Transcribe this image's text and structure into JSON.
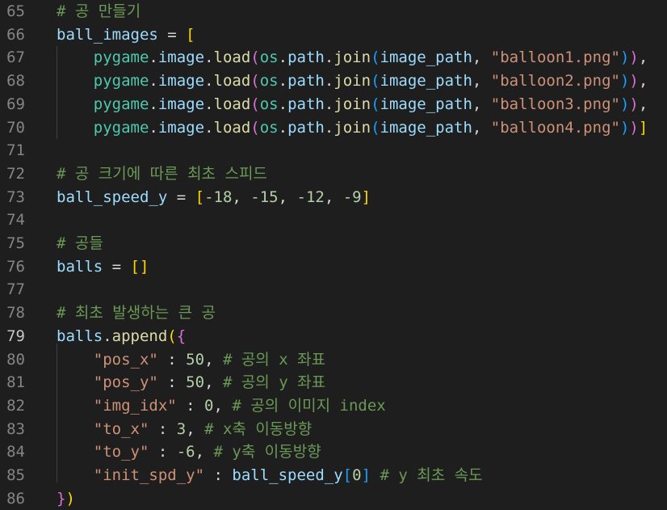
{
  "editor": {
    "active_line": "79",
    "lines": [
      {
        "num": "65",
        "tokens": [
          {
            "t": "# 공 만들기",
            "c": "c"
          }
        ]
      },
      {
        "num": "66",
        "tokens": [
          {
            "t": "ball_images",
            "c": "k"
          },
          {
            "t": " = ",
            "c": "p"
          },
          {
            "t": "[",
            "c": "b1"
          }
        ]
      },
      {
        "num": "67",
        "tokens": [
          {
            "t": "    ",
            "c": "p"
          },
          {
            "t": "pygame",
            "c": "m"
          },
          {
            "t": ".",
            "c": "p"
          },
          {
            "t": "image",
            "c": "k"
          },
          {
            "t": ".",
            "c": "p"
          },
          {
            "t": "load",
            "c": "f"
          },
          {
            "t": "(",
            "c": "b2"
          },
          {
            "t": "os",
            "c": "m"
          },
          {
            "t": ".",
            "c": "p"
          },
          {
            "t": "path",
            "c": "k"
          },
          {
            "t": ".",
            "c": "p"
          },
          {
            "t": "join",
            "c": "f"
          },
          {
            "t": "(",
            "c": "b3"
          },
          {
            "t": "image_path",
            "c": "k"
          },
          {
            "t": ", ",
            "c": "p"
          },
          {
            "t": "\"balloon1.png\"",
            "c": "s"
          },
          {
            "t": ")",
            "c": "b3"
          },
          {
            "t": ")",
            "c": "b2"
          },
          {
            "t": ",",
            "c": "p"
          }
        ]
      },
      {
        "num": "68",
        "tokens": [
          {
            "t": "    ",
            "c": "p"
          },
          {
            "t": "pygame",
            "c": "m"
          },
          {
            "t": ".",
            "c": "p"
          },
          {
            "t": "image",
            "c": "k"
          },
          {
            "t": ".",
            "c": "p"
          },
          {
            "t": "load",
            "c": "f"
          },
          {
            "t": "(",
            "c": "b2"
          },
          {
            "t": "os",
            "c": "m"
          },
          {
            "t": ".",
            "c": "p"
          },
          {
            "t": "path",
            "c": "k"
          },
          {
            "t": ".",
            "c": "p"
          },
          {
            "t": "join",
            "c": "f"
          },
          {
            "t": "(",
            "c": "b3"
          },
          {
            "t": "image_path",
            "c": "k"
          },
          {
            "t": ", ",
            "c": "p"
          },
          {
            "t": "\"balloon2.png\"",
            "c": "s"
          },
          {
            "t": ")",
            "c": "b3"
          },
          {
            "t": ")",
            "c": "b2"
          },
          {
            "t": ",",
            "c": "p"
          }
        ]
      },
      {
        "num": "69",
        "tokens": [
          {
            "t": "    ",
            "c": "p"
          },
          {
            "t": "pygame",
            "c": "m"
          },
          {
            "t": ".",
            "c": "p"
          },
          {
            "t": "image",
            "c": "k"
          },
          {
            "t": ".",
            "c": "p"
          },
          {
            "t": "load",
            "c": "f"
          },
          {
            "t": "(",
            "c": "b2"
          },
          {
            "t": "os",
            "c": "m"
          },
          {
            "t": ".",
            "c": "p"
          },
          {
            "t": "path",
            "c": "k"
          },
          {
            "t": ".",
            "c": "p"
          },
          {
            "t": "join",
            "c": "f"
          },
          {
            "t": "(",
            "c": "b3"
          },
          {
            "t": "image_path",
            "c": "k"
          },
          {
            "t": ", ",
            "c": "p"
          },
          {
            "t": "\"balloon3.png\"",
            "c": "s"
          },
          {
            "t": ")",
            "c": "b3"
          },
          {
            "t": ")",
            "c": "b2"
          },
          {
            "t": ",",
            "c": "p"
          }
        ]
      },
      {
        "num": "70",
        "tokens": [
          {
            "t": "    ",
            "c": "p"
          },
          {
            "t": "pygame",
            "c": "m"
          },
          {
            "t": ".",
            "c": "p"
          },
          {
            "t": "image",
            "c": "k"
          },
          {
            "t": ".",
            "c": "p"
          },
          {
            "t": "load",
            "c": "f"
          },
          {
            "t": "(",
            "c": "b2"
          },
          {
            "t": "os",
            "c": "m"
          },
          {
            "t": ".",
            "c": "p"
          },
          {
            "t": "path",
            "c": "k"
          },
          {
            "t": ".",
            "c": "p"
          },
          {
            "t": "join",
            "c": "f"
          },
          {
            "t": "(",
            "c": "b3"
          },
          {
            "t": "image_path",
            "c": "k"
          },
          {
            "t": ", ",
            "c": "p"
          },
          {
            "t": "\"balloon4.png\"",
            "c": "s"
          },
          {
            "t": ")",
            "c": "b3"
          },
          {
            "t": ")",
            "c": "b2"
          },
          {
            "t": "]",
            "c": "b1"
          }
        ]
      },
      {
        "num": "71",
        "tokens": []
      },
      {
        "num": "72",
        "tokens": [
          {
            "t": "# 공 크기에 따른 최초 스피드",
            "c": "c"
          }
        ]
      },
      {
        "num": "73",
        "tokens": [
          {
            "t": "ball_speed_y",
            "c": "k"
          },
          {
            "t": " = ",
            "c": "p"
          },
          {
            "t": "[",
            "c": "b1"
          },
          {
            "t": "-18",
            "c": "n"
          },
          {
            "t": ", ",
            "c": "p"
          },
          {
            "t": "-15",
            "c": "n"
          },
          {
            "t": ", ",
            "c": "p"
          },
          {
            "t": "-12",
            "c": "n"
          },
          {
            "t": ", ",
            "c": "p"
          },
          {
            "t": "-9",
            "c": "n"
          },
          {
            "t": "]",
            "c": "b1"
          }
        ]
      },
      {
        "num": "74",
        "tokens": []
      },
      {
        "num": "75",
        "tokens": [
          {
            "t": "# 공들",
            "c": "c"
          }
        ]
      },
      {
        "num": "76",
        "tokens": [
          {
            "t": "balls",
            "c": "k"
          },
          {
            "t": " = ",
            "c": "p"
          },
          {
            "t": "[]",
            "c": "b1"
          }
        ]
      },
      {
        "num": "77",
        "tokens": []
      },
      {
        "num": "78",
        "tokens": [
          {
            "t": "# 최초 발생하는 큰 공",
            "c": "c"
          }
        ]
      },
      {
        "num": "79",
        "tokens": [
          {
            "t": "balls",
            "c": "k"
          },
          {
            "t": ".",
            "c": "p"
          },
          {
            "t": "append",
            "c": "f"
          },
          {
            "t": "(",
            "c": "b1"
          },
          {
            "t": "{",
            "c": "b2"
          }
        ]
      },
      {
        "num": "80",
        "tokens": [
          {
            "t": "    ",
            "c": "p"
          },
          {
            "t": "\"pos_x\"",
            "c": "s"
          },
          {
            "t": " : ",
            "c": "p"
          },
          {
            "t": "50",
            "c": "n"
          },
          {
            "t": ", ",
            "c": "p"
          },
          {
            "t": "# 공의 x 좌표",
            "c": "c"
          }
        ]
      },
      {
        "num": "81",
        "tokens": [
          {
            "t": "    ",
            "c": "p"
          },
          {
            "t": "\"pos_y\"",
            "c": "s"
          },
          {
            "t": " : ",
            "c": "p"
          },
          {
            "t": "50",
            "c": "n"
          },
          {
            "t": ", ",
            "c": "p"
          },
          {
            "t": "# 공의 y 좌표",
            "c": "c"
          }
        ]
      },
      {
        "num": "82",
        "tokens": [
          {
            "t": "    ",
            "c": "p"
          },
          {
            "t": "\"img_idx\"",
            "c": "s"
          },
          {
            "t": " : ",
            "c": "p"
          },
          {
            "t": "0",
            "c": "n"
          },
          {
            "t": ", ",
            "c": "p"
          },
          {
            "t": "# 공의 이미지 index",
            "c": "c"
          }
        ]
      },
      {
        "num": "83",
        "tokens": [
          {
            "t": "    ",
            "c": "p"
          },
          {
            "t": "\"to_x\"",
            "c": "s"
          },
          {
            "t": " : ",
            "c": "p"
          },
          {
            "t": "3",
            "c": "n"
          },
          {
            "t": ", ",
            "c": "p"
          },
          {
            "t": "# x축 이동방향",
            "c": "c"
          }
        ]
      },
      {
        "num": "84",
        "tokens": [
          {
            "t": "    ",
            "c": "p"
          },
          {
            "t": "\"to_y\"",
            "c": "s"
          },
          {
            "t": " : ",
            "c": "p"
          },
          {
            "t": "-6",
            "c": "n"
          },
          {
            "t": ", ",
            "c": "p"
          },
          {
            "t": "# y축 이동방향",
            "c": "c"
          }
        ]
      },
      {
        "num": "85",
        "tokens": [
          {
            "t": "    ",
            "c": "p"
          },
          {
            "t": "\"init_spd_y\"",
            "c": "s"
          },
          {
            "t": " : ",
            "c": "p"
          },
          {
            "t": "ball_speed_y",
            "c": "k"
          },
          {
            "t": "[",
            "c": "b3"
          },
          {
            "t": "0",
            "c": "n"
          },
          {
            "t": "]",
            "c": "b3"
          },
          {
            "t": " ",
            "c": "p"
          },
          {
            "t": "# y 최초 속도",
            "c": "c"
          }
        ]
      },
      {
        "num": "86",
        "tokens": [
          {
            "t": "}",
            "c": "b2"
          },
          {
            "t": ")",
            "c": "b1"
          }
        ]
      }
    ]
  },
  "colors": {
    "background": "#1e1e1e",
    "comment": "#6a9955",
    "string": "#ce9178",
    "number": "#b5cea8",
    "variable": "#9cdcfe",
    "function": "#dcdcaa",
    "module": "#4ec9b0",
    "bracket_1": "#ffd700",
    "bracket_2": "#da70d6",
    "bracket_3": "#179fff"
  }
}
